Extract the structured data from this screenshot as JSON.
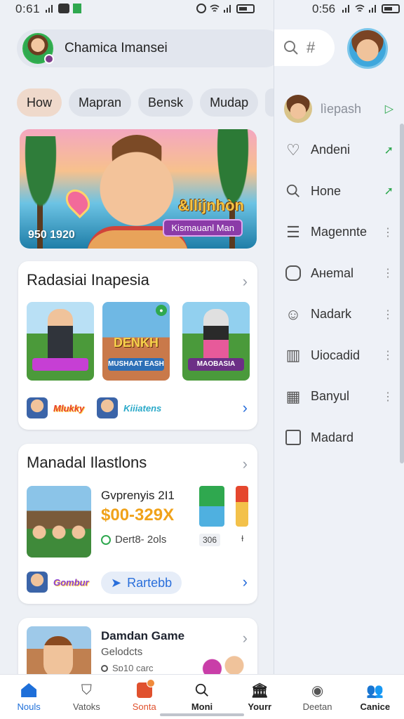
{
  "status": {
    "time_left": "0:61",
    "time_right": "0:56"
  },
  "account": {
    "name": "Chamica Imansei"
  },
  "chips": [
    "How",
    "Mapran",
    "Bensk",
    "Mudap"
  ],
  "hero": {
    "title": "&llijnhòn",
    "tag": "Kismauanl Man",
    "count": "950 1920"
  },
  "card1": {
    "title": "Radasiai Inapesia",
    "thumbs": [
      {
        "tag": ""
      },
      {
        "big": "DENKH",
        "tag": "MUSHAAT EASHAIN"
      },
      {
        "tag": "MAOBASIA"
      }
    ],
    "mini_logos": [
      "Mlukky",
      "Kiiiatens"
    ]
  },
  "card2": {
    "title": "Manadal Ilastlons",
    "product_name": "Gvprenyis 2I1",
    "price": "$00-329X",
    "meta": "Dert8- 2ols",
    "side_num": "306",
    "side_num2": "Ɨ",
    "mini_logo": "Gombur",
    "rate_label": "Rartebb"
  },
  "card3": {
    "name": "Damdan Game",
    "sub": "Gelodcts",
    "meta": "Sɒ10 carc"
  },
  "panel": {
    "search_icons": [
      "search-icon",
      "hash-icon"
    ],
    "items": [
      {
        "label": "lìepash",
        "trail": "▷"
      },
      {
        "label": "Andeni",
        "trail": "➚"
      },
      {
        "label": "Hone",
        "trail": "➚"
      },
      {
        "label": "Magennte",
        "trail": "⋮"
      },
      {
        "label": "Aнemal",
        "trail": "⋮"
      },
      {
        "label": "Nadark",
        "trail": "⋮"
      },
      {
        "label": "Uiocadid",
        "trail": "⋮"
      },
      {
        "label": "Banyul",
        "trail": "⋮"
      },
      {
        "label": "Madard",
        "trail": ""
      }
    ]
  },
  "bottom_nav": [
    "Nouls",
    "Vatoks",
    "Sonta",
    "Moni",
    "Yourr",
    "Deetan",
    "Canice"
  ]
}
